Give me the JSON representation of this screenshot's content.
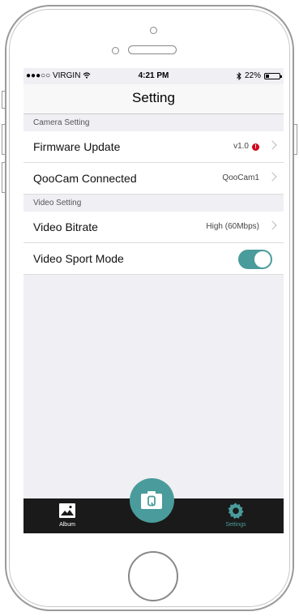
{
  "status": {
    "carrier": "●●●○○ VIRGIN",
    "time": "4:21 PM",
    "battery": "22%",
    "battery_level": 0.22
  },
  "nav": {
    "title": "Setting"
  },
  "sections": {
    "camera": "Camera Setting",
    "video": "Video Setting"
  },
  "rows": {
    "firmware": {
      "label": "Firmware Update",
      "value": "v1.0"
    },
    "connected": {
      "label": "QooCam Connected",
      "value": "QooCam1"
    },
    "bitrate": {
      "label": "Video Bitrate",
      "value": "High (60Mbps)"
    },
    "sport": {
      "label": "Video Sport Mode",
      "enabled": true
    }
  },
  "tabs": {
    "album": "Album",
    "settings": "Settings"
  },
  "colors": {
    "accent": "#4a9b9b",
    "tab_bg": "#1a1a1a",
    "alert": "#d0021b"
  },
  "icons": {
    "album": "image-icon",
    "camera": "camera-icon",
    "settings": "gear-icon"
  }
}
